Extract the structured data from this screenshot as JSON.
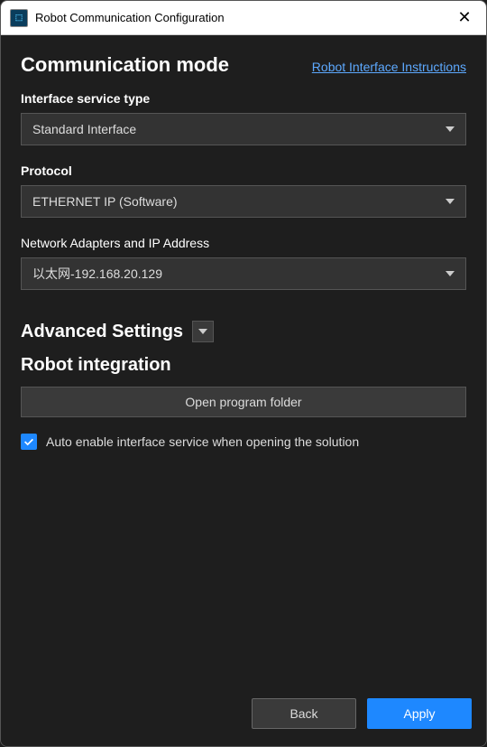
{
  "titlebar": {
    "title": "Robot Communication Configuration"
  },
  "section": {
    "title": "Communication mode",
    "link": "Robot Interface Instructions"
  },
  "fields": {
    "interface_label": "Interface service type",
    "interface_value": "Standard Interface",
    "protocol_label": "Protocol",
    "protocol_value": "ETHERNET IP (Software)",
    "adapter_label": "Network Adapters and IP Address",
    "adapter_value": "以太网-192.168.20.129"
  },
  "advanced": {
    "title": "Advanced Settings"
  },
  "integration": {
    "title": "Robot integration",
    "open_folder": "Open program folder",
    "auto_enable": "Auto enable interface service when opening the solution"
  },
  "footer": {
    "back": "Back",
    "apply": "Apply"
  }
}
